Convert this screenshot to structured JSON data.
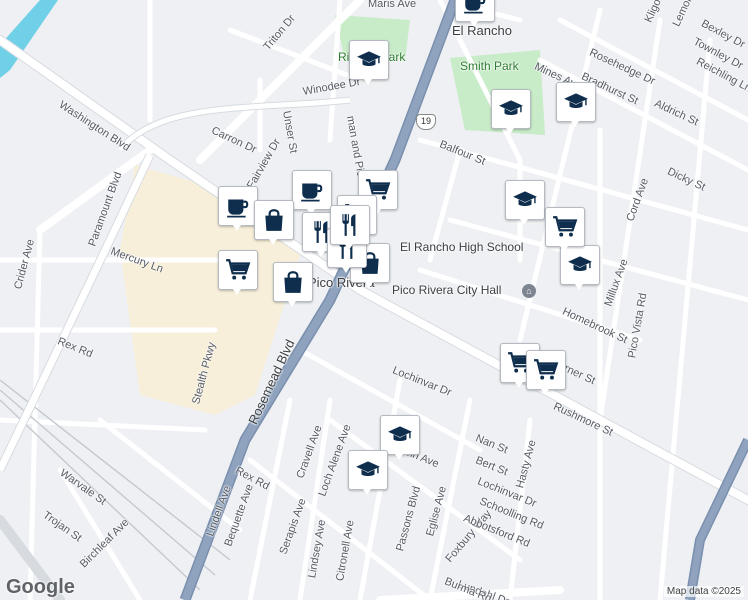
{
  "map": {
    "attribution": "Map data ©2025",
    "brand": "Google",
    "colors": {
      "background": "#eef0f3",
      "road": "#ffffff",
      "road_outline": "#d7dbe0",
      "freeway": "#8fa3bf",
      "industrial": "#f7efd9",
      "park": "#c8ebc8",
      "water": "#6fd0e8",
      "pin_icon": "#0f2e4d"
    },
    "highway_shield": "19",
    "place_labels": {
      "city": "Pico Rivera",
      "neighborhood": "El Rancho",
      "school": "El Rancho High School",
      "city_hall": "Pico Rivera City Hall",
      "park_smith": "Smith Park",
      "park_rio": "Rio Rio Park"
    },
    "street_labels": [
      "Maris Ave",
      "Triton Dr",
      "Unser St",
      "Winodee Dr",
      "Carron Dr",
      "Washington Blvd",
      "Paramount Blvd",
      "Mercury Ln",
      "Crider Ave",
      "Rex Rd",
      "Stealth Pkwy",
      "Rosemead Blvd",
      "Warvale St",
      "Trojan St",
      "Birchleaf Ave",
      "Lindell Ave",
      "Bequette Ave",
      "Serapis Ave",
      "Cravell Ave",
      "Loch Alene Ave",
      "Lindsey Ave",
      "Citronell Ave",
      "Passons Blvd",
      "Eglise Ave",
      "Foxbury Way",
      "Lundahl Dr",
      "Burma Rd",
      "Lochinvar Dr",
      "Nan St",
      "Bert St",
      "Hasty Ave",
      "Schoolling Rd",
      "Abbotsford Rd",
      "Balfour St",
      "Homebrook St",
      "Rushmore St",
      "Pico Vista Rd",
      "Millux Ave",
      "Cord Ave",
      "Dicky St",
      "Mines Ave",
      "Aldrich St",
      "Reichling Ln",
      "Rosehedge Dr",
      "Bradhurst St",
      "Bexley Dr",
      "Townley Dr",
      "Lemoran Ave",
      "Kligor",
      "Fairview Dr",
      "Warner St",
      "Rex Rd",
      "Lochinvar Dr",
      "man and Pico Rd",
      "Robin Ave"
    ],
    "pins": [
      {
        "type": "school",
        "icon": "school-icon"
      },
      {
        "type": "school",
        "icon": "school-icon"
      },
      {
        "type": "school",
        "icon": "school-icon"
      },
      {
        "type": "school",
        "icon": "school-icon"
      },
      {
        "type": "school",
        "icon": "school-icon"
      },
      {
        "type": "school",
        "icon": "school-icon"
      },
      {
        "type": "school",
        "icon": "school-icon"
      },
      {
        "type": "cafe",
        "icon": "coffee-cup-icon"
      },
      {
        "type": "cafe",
        "icon": "coffee-cup-icon"
      },
      {
        "type": "cafe",
        "icon": "coffee-cup-icon"
      },
      {
        "type": "grocery",
        "icon": "shopping-cart-icon"
      },
      {
        "type": "grocery",
        "icon": "shopping-cart-icon"
      },
      {
        "type": "grocery",
        "icon": "shopping-cart-icon"
      },
      {
        "type": "grocery",
        "icon": "shopping-cart-icon"
      },
      {
        "type": "grocery",
        "icon": "shopping-cart-icon"
      },
      {
        "type": "grocery",
        "icon": "shopping-cart-icon"
      },
      {
        "type": "shopping",
        "icon": "shopping-bag-icon"
      },
      {
        "type": "shopping",
        "icon": "shopping-bag-icon"
      },
      {
        "type": "shopping",
        "icon": "shopping-bag-icon"
      },
      {
        "type": "restaurant",
        "icon": "fork-knife-icon"
      },
      {
        "type": "restaurant",
        "icon": "fork-knife-icon"
      },
      {
        "type": "restaurant",
        "icon": "fork-knife-icon"
      }
    ]
  }
}
